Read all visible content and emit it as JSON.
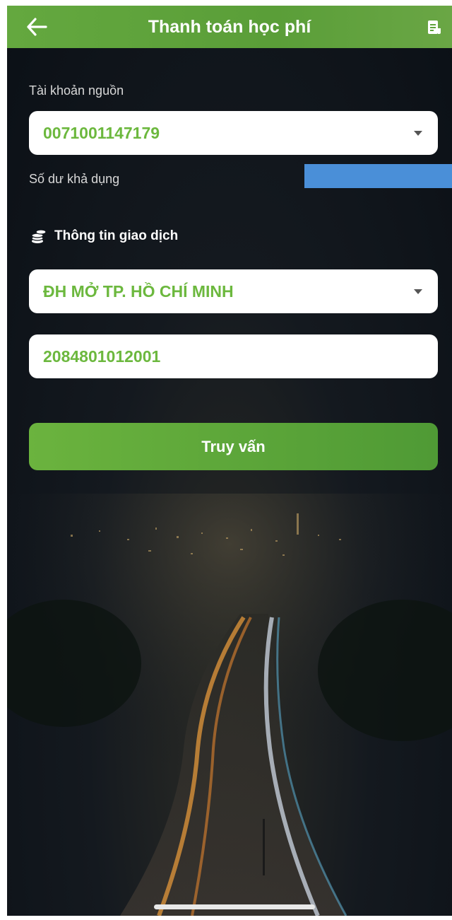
{
  "header": {
    "title": "Thanh toán học phí",
    "back_icon": "arrow-left-icon",
    "history_icon": "receipt-icon",
    "background": "#5fa33b"
  },
  "source_account": {
    "label": "Tài khoản nguồn",
    "value": "0071001147179",
    "balance_label": "Số dư khả dụng"
  },
  "transaction": {
    "section_title": "Thông tin giao dịch",
    "section_icon": "coins-icon",
    "university_value": "ĐH MỞ TP. HỒ CHÍ MINH",
    "student_id_value": "2084801012001"
  },
  "actions": {
    "query_label": "Truy vấn"
  },
  "colors": {
    "accent": "#6cb83e",
    "balance_mask": "#4a8fd8",
    "background": "#11171d"
  }
}
